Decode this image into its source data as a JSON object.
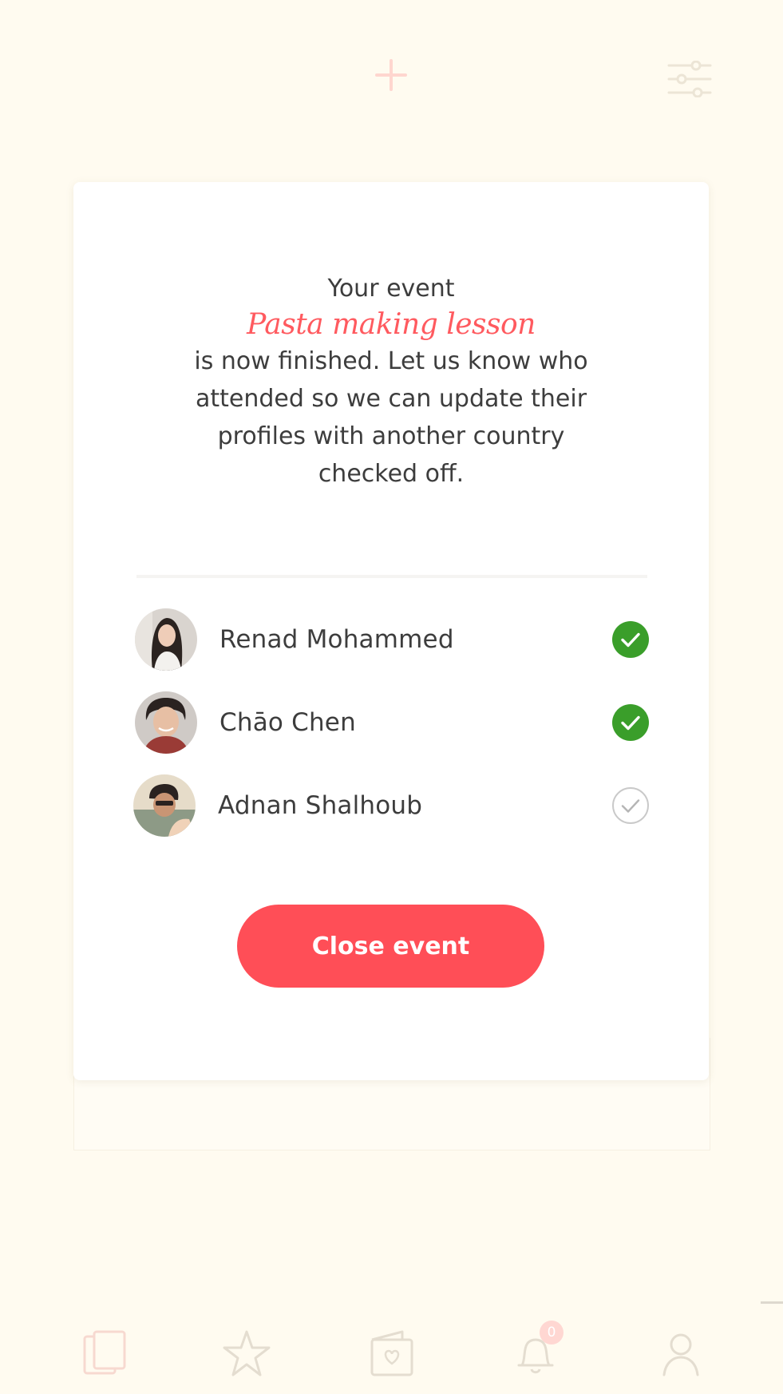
{
  "modal": {
    "intro": "Your event",
    "event_name": "Pasta making lesson",
    "message": "is now finished. Let us know who attended so we can update their profiles with another country checked off.",
    "close_button_label": "Close event"
  },
  "attendees": [
    {
      "name": "Renad Mohammed",
      "attended": true,
      "icon": "check-circle-icon"
    },
    {
      "name": "Chāo Chen",
      "attended": true,
      "icon": "check-circle-icon"
    },
    {
      "name": "Adnan Shalhoub",
      "attended": false,
      "icon": "check-circle-outline-icon"
    }
  ],
  "top_bar": {
    "icons": [
      "plus-icon",
      "filter-sliders-icon"
    ]
  },
  "tab_bar": {
    "icons": [
      "cards-icon",
      "star-icon",
      "passport-heart-icon",
      "bell-icon",
      "profile-icon"
    ],
    "notifications_badge": "0"
  },
  "colors": {
    "background": "#fffbf0",
    "accent": "#ff5a5f",
    "button": "#ff4e57",
    "checked": "#3a9e2a",
    "text": "#3d3d3d"
  }
}
